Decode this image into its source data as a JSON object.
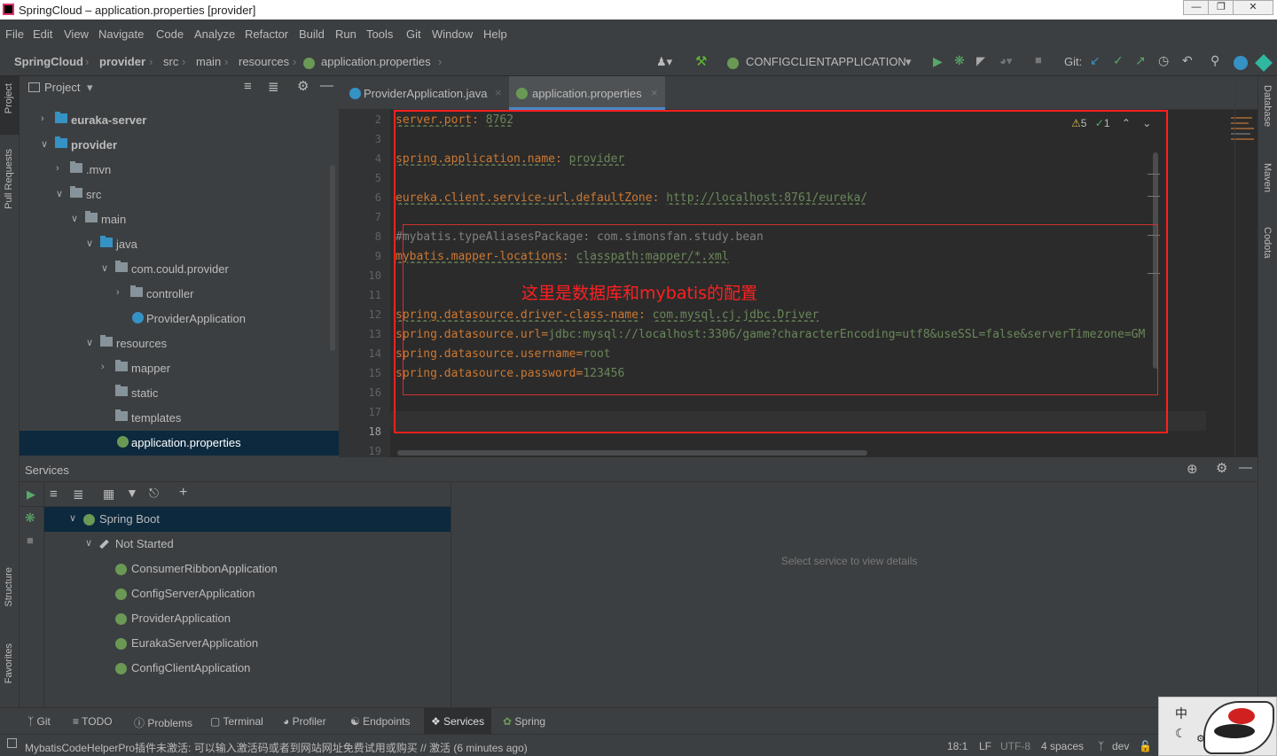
{
  "window": {
    "title": "SpringCloud – application.properties [provider]"
  },
  "menu": [
    "File",
    "Edit",
    "View",
    "Navigate",
    "Code",
    "Analyze",
    "Refactor",
    "Build",
    "Run",
    "Tools",
    "Git",
    "Window",
    "Help"
  ],
  "breadcrumb": [
    "SpringCloud",
    "provider",
    "src",
    "main",
    "resources",
    "application.properties"
  ],
  "run_config": "CONFIGCLIENTAPPLICATION",
  "git_label": "Git:",
  "project_panel": {
    "title": "Project",
    "items": [
      {
        "label": "euraka-server",
        "indent": 1,
        "type": "module",
        "expanded": false
      },
      {
        "label": "provider",
        "indent": 1,
        "type": "module",
        "expanded": true
      },
      {
        "label": ".mvn",
        "indent": 2,
        "type": "folder",
        "expanded": false
      },
      {
        "label": "src",
        "indent": 2,
        "type": "folder",
        "expanded": true
      },
      {
        "label": "main",
        "indent": 3,
        "type": "folder",
        "expanded": true
      },
      {
        "label": "java",
        "indent": 4,
        "type": "src-folder",
        "expanded": true
      },
      {
        "label": "com.could.provider",
        "indent": 5,
        "type": "package",
        "expanded": true
      },
      {
        "label": "controller",
        "indent": 6,
        "type": "package",
        "expanded": false
      },
      {
        "label": "ProviderApplication",
        "indent": 6,
        "type": "spring-class"
      },
      {
        "label": "resources",
        "indent": 4,
        "type": "res-folder",
        "expanded": true
      },
      {
        "label": "mapper",
        "indent": 5,
        "type": "folder",
        "expanded": false
      },
      {
        "label": "static",
        "indent": 5,
        "type": "folder"
      },
      {
        "label": "templates",
        "indent": 5,
        "type": "folder"
      },
      {
        "label": "application.properties",
        "indent": 5,
        "type": "properties",
        "selected": true
      }
    ]
  },
  "editor": {
    "tabs": [
      {
        "label": "ProviderApplication.java",
        "active": false
      },
      {
        "label": "application.properties",
        "active": true
      }
    ],
    "inspections": {
      "warnings": "5",
      "weak": "1"
    },
    "annotation": "这里是数据库和mybatis的配置",
    "lines": [
      {
        "n": "2",
        "key": "server.port",
        "sep": ": ",
        "val": "8762"
      },
      {
        "n": "3"
      },
      {
        "n": "4",
        "key": "spring.application.name",
        "sep": ": ",
        "val": "provider"
      },
      {
        "n": "5"
      },
      {
        "n": "6",
        "key": "eureka.client.service-url.defaultZone",
        "sep": ": ",
        "val": "http://localhost:8761/eureka/"
      },
      {
        "n": "7"
      },
      {
        "n": "8",
        "comment": "#mybatis.typeAliasesPackage: com.simonsfan.study.bean"
      },
      {
        "n": "9",
        "key": "mybatis.mapper-locations",
        "sep": ": ",
        "val": "classpath:mapper/*.xml"
      },
      {
        "n": "10"
      },
      {
        "n": "11"
      },
      {
        "n": "12",
        "key": "spring.datasource.driver-class-name",
        "sep": ": ",
        "val": "com.mysql.cj.jdbc.Driver"
      },
      {
        "n": "13",
        "key": "spring.datasource.url",
        "sep": "=",
        "val": "jdbc:mysql://localhost:3306/game?characterEncoding=utf8&useSSL=false&serverTimezone=GM"
      },
      {
        "n": "14",
        "key": "spring.datasource.username",
        "sep": "=",
        "val": "root"
      },
      {
        "n": "15",
        "key": "spring.datasource.password",
        "sep": "=",
        "val": "123456"
      },
      {
        "n": "16"
      },
      {
        "n": "17"
      },
      {
        "n": "18"
      },
      {
        "n": "19"
      }
    ]
  },
  "services": {
    "title": "Services",
    "root": "Spring Boot",
    "group": "Not Started",
    "apps": [
      "ConsumerRibbonApplication",
      "ConfigServerApplication",
      "ProviderApplication",
      "EurakaServerApplication",
      "ConfigClientApplication"
    ],
    "empty_text": "Select service to view details"
  },
  "left_strip": [
    "Project",
    "Pull Requests",
    "Structure",
    "Favorites"
  ],
  "right_strip": [
    "Database",
    "Maven",
    "Codota"
  ],
  "tool_windows": [
    "Git",
    "TODO",
    "Problems",
    "Terminal",
    "Profiler",
    "Endpoints",
    "Services",
    "Spring"
  ],
  "status": {
    "message": "MybatisCodeHelperPro插件未激活: 可以输入激活码或者到网站网址免费试用或购买 // 激活 (6 minutes ago)",
    "position": "18:1",
    "line_sep": "LF",
    "encoding": "UTF-8",
    "indent": "4 spaces",
    "branch": "dev"
  },
  "ime": {
    "label": "中"
  },
  "colors": {
    "accent": "#4a88c7",
    "annotation_red": "#ff2020",
    "key": "#cc7832",
    "value": "#6a8759"
  }
}
